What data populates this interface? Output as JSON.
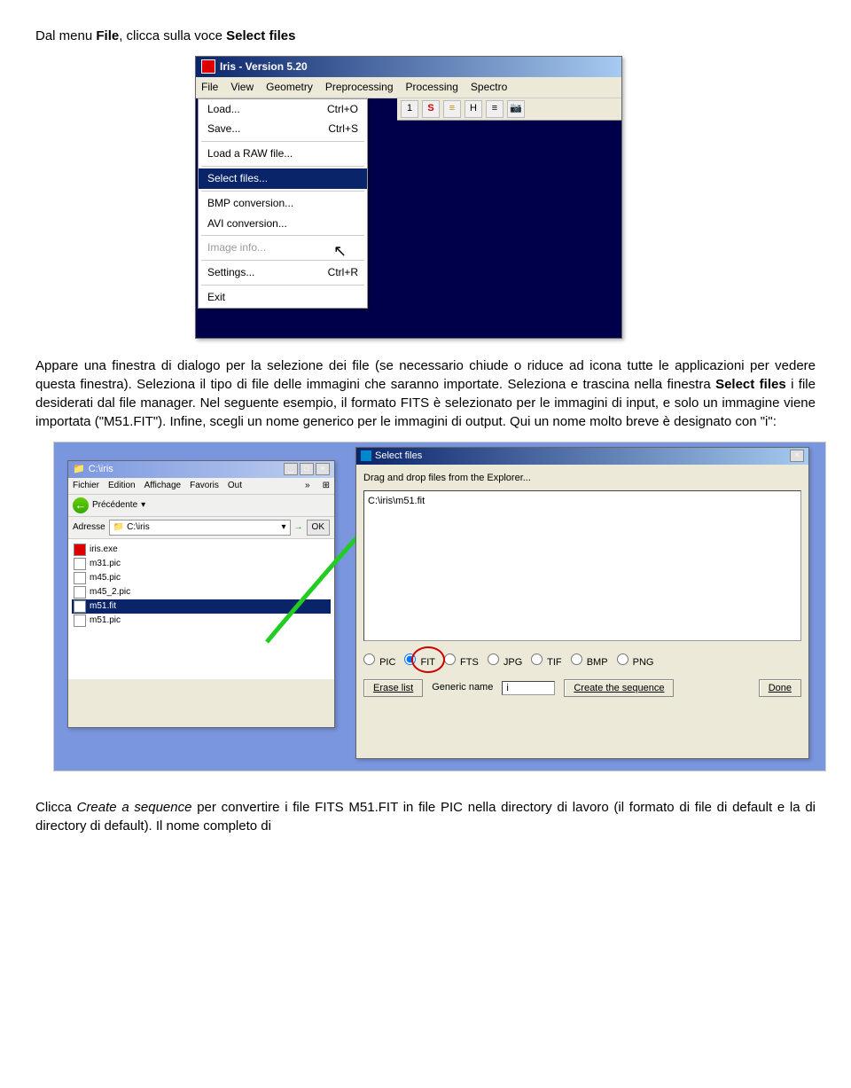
{
  "doc": {
    "p1_a": "Dal menu ",
    "p1_b": "File",
    "p1_c": ", clicca sulla voce ",
    "p1_d": "Select files",
    "p2_a": "Appare una finestra di dialogo per la selezione dei file (se necessario chiude o riduce ad icona tutte le applicazioni per vedere questa finestra). Seleziona il tipo di file delle immagini che saranno importate. Seleziona e trascina nella finestra ",
    "p2_b": "Select files",
    "p2_c": " i file desiderati dal file manager. Nel seguente esempio, il formato FITS è selezionato per le immagini di input, e solo un immagine viene importata (\"M51.FIT\"). Infine, scegli un nome generico per le immagini di output. Qui un nome molto breve è designato con \"i\":",
    "p3_a": "Clicca ",
    "p3_b": "Create a sequence",
    "p3_c": " per convertire i file FITS M51.FIT in file PIC nella directory di lavoro (il formato di file di default e la di directory di default). Il nome completo di"
  },
  "iris": {
    "title": "Iris - Version 5.20",
    "menubar": [
      "File",
      "View",
      "Geometry",
      "Preprocessing",
      "Processing",
      "Spectro"
    ],
    "dropdown": [
      {
        "label": "Load...",
        "shortcut": "Ctrl+O"
      },
      {
        "label": "Save...",
        "shortcut": "Ctrl+S"
      },
      {
        "sep": true
      },
      {
        "label": "Load a RAW file..."
      },
      {
        "sep": true
      },
      {
        "label": "Select files...",
        "selected": true
      },
      {
        "sep": true
      },
      {
        "label": "BMP conversion..."
      },
      {
        "label": "AVI conversion..."
      },
      {
        "sep": true
      },
      {
        "label": "Image info...",
        "disabled": true
      },
      {
        "sep": true
      },
      {
        "label": "Settings...",
        "shortcut": "Ctrl+R"
      },
      {
        "sep": true
      },
      {
        "label": "Exit"
      }
    ],
    "toolbar_icons": [
      "1",
      "S",
      "≡",
      "H",
      "≡",
      "📷"
    ]
  },
  "explorer": {
    "title": "C:\\iris",
    "menu": [
      "Fichier",
      "Edition",
      "Affichage",
      "Favoris",
      "Out"
    ],
    "back_label": "Précédente",
    "addr_label": "Adresse",
    "addr_value": "C:\\iris",
    "ok": "OK",
    "files": [
      {
        "name": "iris.exe",
        "red": true
      },
      {
        "name": "m31.pic"
      },
      {
        "name": "m45.pic"
      },
      {
        "name": "m45_2.pic"
      },
      {
        "name": "m51.fit",
        "selected": true
      },
      {
        "name": "m51.pic"
      }
    ]
  },
  "selectfiles": {
    "title": "Select files",
    "hint": "Drag and drop files from the Explorer...",
    "dropped": "C:\\iris\\m51.fit",
    "radios": [
      "PIC",
      "FIT",
      "FTS",
      "JPG",
      "TIF",
      "BMP",
      "PNG"
    ],
    "radio_selected": "FIT",
    "erase": "Erase list",
    "generic_label": "Generic name",
    "generic_value": "i",
    "create": "Create the sequence",
    "done": "Done"
  }
}
